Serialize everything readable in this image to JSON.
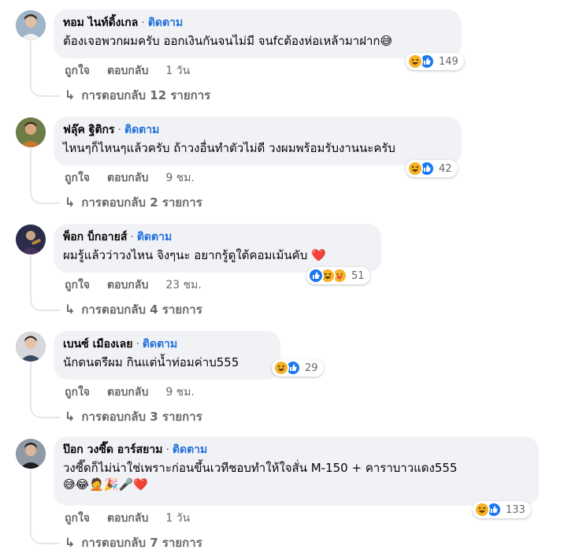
{
  "colors": {
    "bubble": "#f0f2f5",
    "follow": "#216fdb",
    "muted": "#65676b",
    "like": "#1877f2",
    "haha": "#f7b125",
    "love": "#f33e58"
  },
  "comments": [
    {
      "author": "ทอม ไนท์ดิ้งเกล",
      "follow": "ติดตาม",
      "separator": "·",
      "text": "ต้องเจอพวกผมครับ ออกเงินกันจนไม่มี จนfcต้องห่อเหล้ามาฝาก😅",
      "emoji_line": "",
      "reactions": [
        "haha-icon",
        "like-icon"
      ],
      "reaction_count": "149",
      "like_label": "ถูกใจ",
      "reply_label": "ตอบกลับ",
      "time": "1 วัน",
      "replies_arrow": "↳",
      "replies": "การตอบกลับ 12 รายการ"
    },
    {
      "author": "ฟลุ๊ค ฐิติกร",
      "follow": "ติดตาม",
      "separator": "·",
      "text": "ไหนๆก็ไหนๆแล้วครับ ถ้าวงอื่นทำตัวไม่ดี วงผมพร้อมรับงานนะครับ",
      "emoji_line": "",
      "reactions": [
        "haha-icon",
        "like-icon"
      ],
      "reaction_count": "42",
      "like_label": "ถูกใจ",
      "reply_label": "ตอบกลับ",
      "time": "9 ชม.",
      "replies_arrow": "↳",
      "replies": "การตอบกลับ 2 รายการ"
    },
    {
      "author": "พ็อก บ็กอายส์",
      "follow": "ติดตาม",
      "separator": "·",
      "text": "ผมรู้แล้วว่าวงไหน จิงๆนะ อยากรู้ดูใต้คอมเม้นคับ ❤️",
      "emoji_line": "",
      "reactions": [
        "like-icon",
        "haha-icon",
        "care-icon"
      ],
      "reaction_count": "51",
      "like_label": "ถูกใจ",
      "reply_label": "ตอบกลับ",
      "time": "23 ชม.",
      "replies_arrow": "↳",
      "replies": "การตอบกลับ 4 รายการ"
    },
    {
      "author": "เบนซ์ เมืองเลย",
      "follow": "ติดตาม",
      "separator": "·",
      "text": "นักดนตรีผม กินแต่น้ำท่อมค่าบ555",
      "emoji_line": "",
      "reactions": [
        "haha-icon",
        "like-icon"
      ],
      "reaction_count": "29",
      "like_label": "ถูกใจ",
      "reply_label": "ตอบกลับ",
      "time": "9 ชม.",
      "replies_arrow": "↳",
      "replies": "การตอบกลับ 3 รายการ"
    },
    {
      "author": "ป๊อก วงซี๊ด อาร์สยาม",
      "follow": "ติดตาม",
      "separator": "·",
      "text": "วงซี๊ดก็ไม่น่าใช่เพราะก่อนขึ้นเวทีชอบทำให้ใจสั่น M-150 + คาราบาวแดง555",
      "emoji_line": "😅😂🤦🎉🎤❤️",
      "reactions": [
        "haha-icon",
        "like-icon"
      ],
      "reaction_count": "133",
      "like_label": "ถูกใจ",
      "reply_label": "ตอบกลับ",
      "time": "1 วัน",
      "replies_arrow": "↳",
      "replies": "การตอบกลับ 7 รายการ"
    }
  ]
}
